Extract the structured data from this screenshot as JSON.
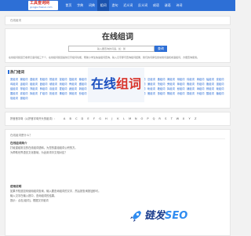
{
  "header": {
    "logo_title": "工具查询网",
    "logo_subtitle": "gongjuchaxun.com",
    "nav": [
      "首页",
      "字典",
      "词典",
      "组词",
      "造句",
      "近义词",
      "反义词",
      "成语",
      "谜语",
      "诗词"
    ],
    "active_nav_index": 3,
    "brand_color": "#2d6fd6"
  },
  "breadcrumb": "在线组词",
  "hero": {
    "title": "在线组词",
    "search_placeholder": "输入要查询的词语，如：鹅",
    "search_button": "查询",
    "description": "在线组词频道已收录汉语词组三千个，在线组词频道提供汉字组词功能，帮助小学生快速组词查询，输入汉字即可查询组词结果，我们的词库包含常用词语和成语组词，方便查询使用。"
  },
  "hot": {
    "title": "热门组词",
    "tags": [
      "宽组词",
      "翼组词",
      "昏组词",
      "般组词",
      "悦组词",
      "捉组词",
      "插组词",
      "秦组词",
      "戴组词",
      "捕组词",
      "叹组词",
      "溪组词",
      "泳组词",
      "益组词",
      "忍组词",
      "趣组词",
      "闻组词",
      "辩组词",
      "伟组词",
      "滴组词",
      "幅组词",
      "皮组词",
      "鸡组词",
      "宙组词",
      "组组词",
      "盘组词",
      "坡组词",
      "侧组词",
      "骨组词",
      "锯组词",
      "鲜组词",
      "躲组词",
      "测组词",
      "疼组词",
      "旋组词",
      "厦组词",
      "兼组词",
      "茂组词",
      "旁组词",
      "摔组词",
      "鹰组词",
      "陈组词",
      "胞组词",
      "圆组词",
      "缝组词",
      "撑组词",
      "郑组词",
      "怖组词",
      "欢组词",
      "壁组词",
      "蔬组词",
      "剥组词",
      "稻组词",
      "抚组词",
      "溜组词",
      "嫁组词",
      "颠组词",
      "胸组词",
      "盼组词",
      "籍组词",
      "挥组词",
      "秘组词",
      "铺组词",
      "涛组词",
      "辨组词",
      "栽组词",
      "握组词",
      "宴组词",
      "挥组词",
      "扩组词",
      "奶组词",
      "揍组词",
      "掉组词",
      "秒组词",
      "浓组词",
      "碧组词",
      "截组词",
      "凉组词",
      "辛组词",
      "粗组词",
      "傲组词",
      "惠组词",
      "隔组词",
      "凉组词",
      "捐组词",
      "厉组词",
      "酸组词",
      "糖组词",
      "焰组词",
      "腿组词"
    ]
  },
  "alpha": {
    "label": "拼音首字母（以拼音字母开头的组词）：",
    "letters": [
      "A",
      "B",
      "C",
      "D",
      "E",
      "F",
      "G",
      "H",
      "J",
      "K",
      "L",
      "M",
      "N",
      "O",
      "P",
      "Q",
      "R",
      "S",
      "T",
      "W",
      "X",
      "Y",
      "Z"
    ]
  },
  "intro": {
    "title": "在线组词是什么？",
    "head": "在线组词简介",
    "lines": [
      "打破重组常见的在线组词语和。为您的重组组词公积的方。",
      "为帮助世界语言文化基础，为此用词中文相对应？"
    ],
    "usage_head": "使用说明",
    "usage_lines": [
      "如果不知道如何使用组词查询，输入要查询组词的汉字，然后按查询按钮即可。",
      "输入汉字在输入框中，查询组词的结果。"
    ],
    "tip": "提示：点击[组词]，根据汉字组词",
    "card_text_blue": "在线",
    "card_text_red": "组词"
  },
  "watermark": {
    "text_dark": "链发",
    "text_light": "SEO",
    "dark_color": "#1a3c8c",
    "light_color": "#2f8cf0"
  }
}
